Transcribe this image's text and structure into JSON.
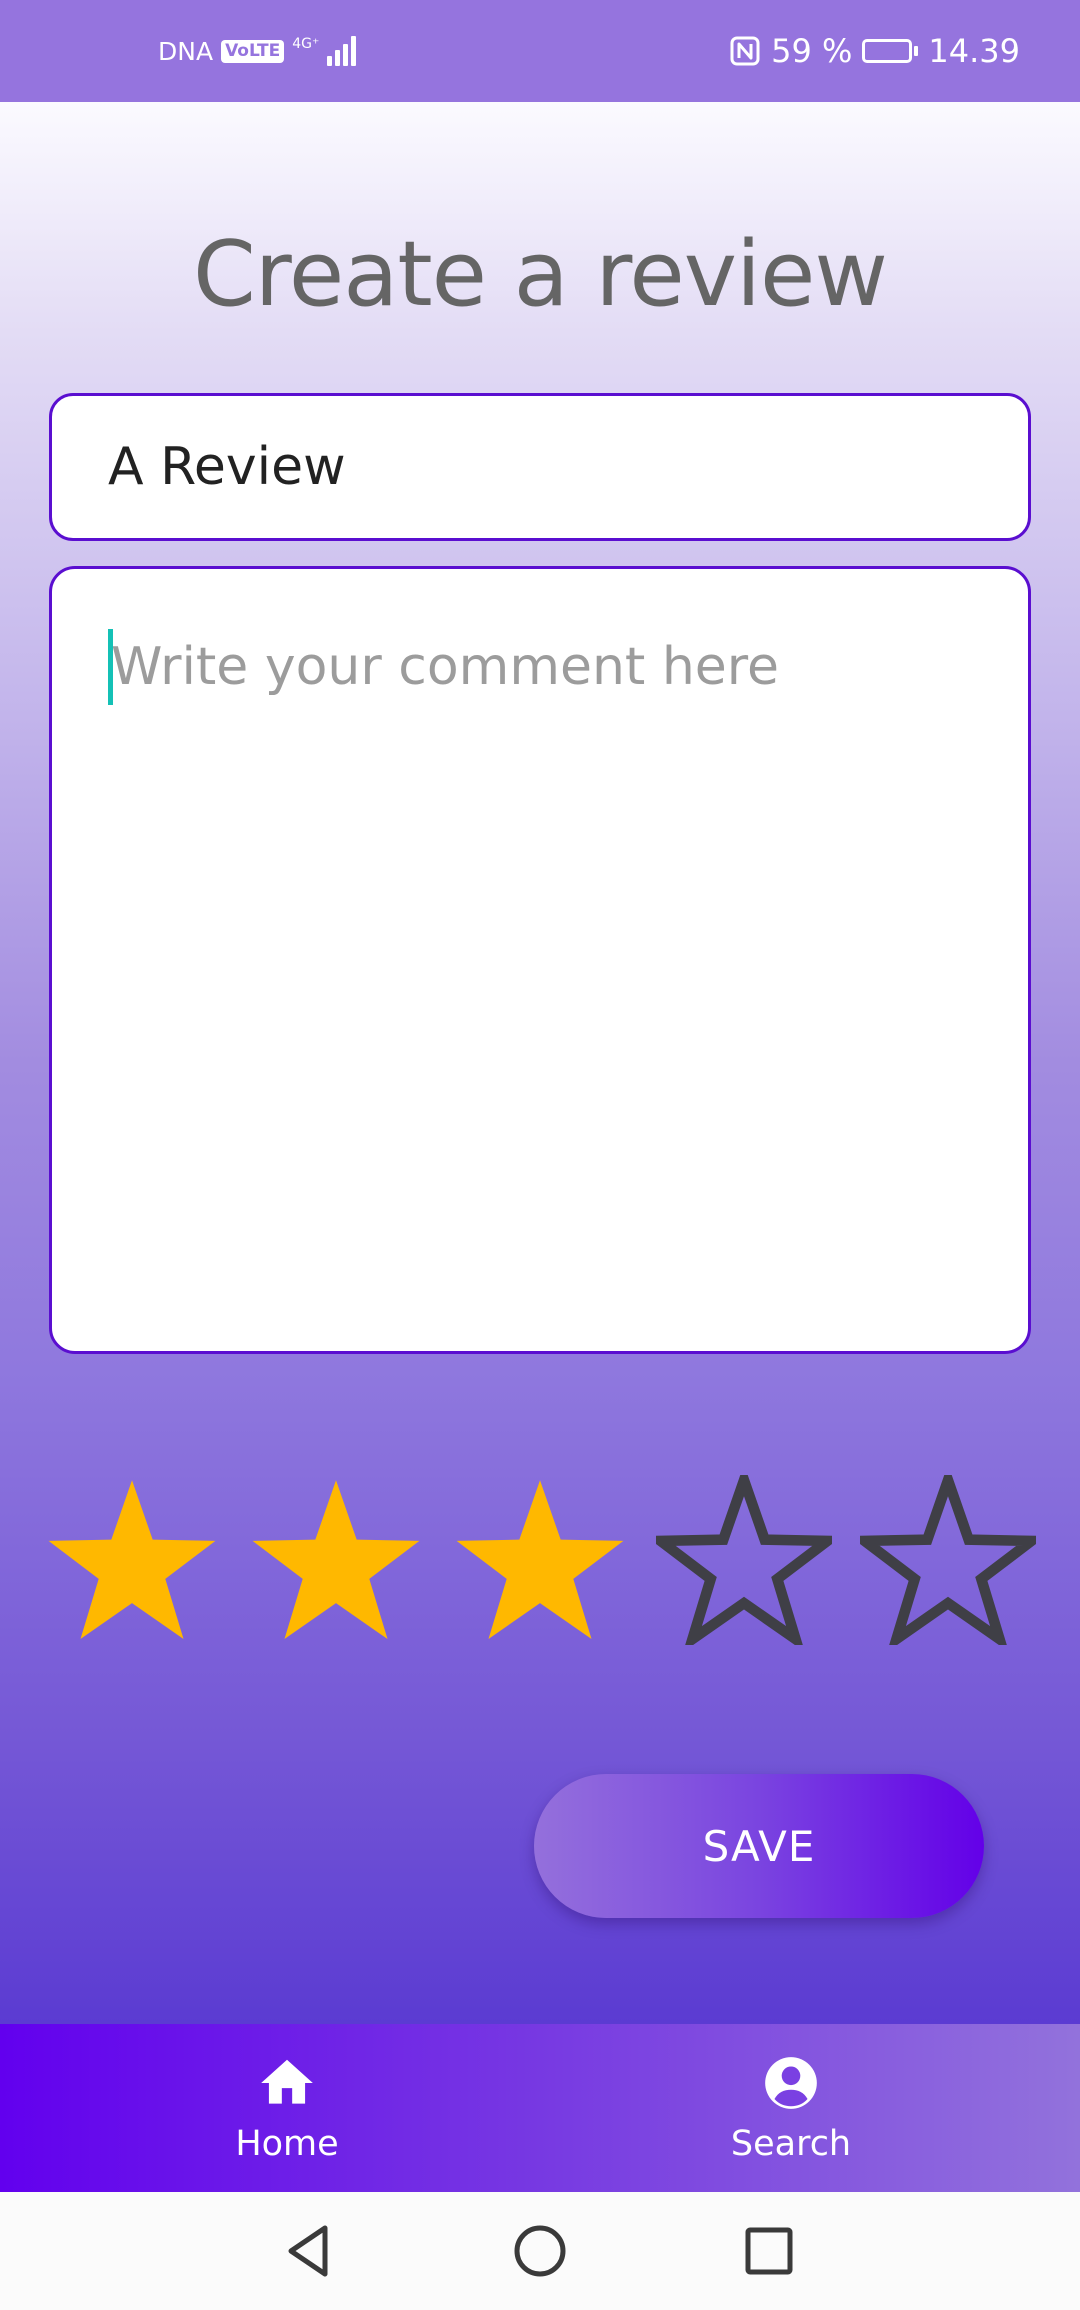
{
  "status_bar": {
    "carrier": "DNA",
    "volte": "VoLTE",
    "network": "4G⁺",
    "battery_percent": "59 %",
    "battery_level": 0.59,
    "time": "14.39"
  },
  "page": {
    "title": "Create a review"
  },
  "form": {
    "title_value": "A Review",
    "comment_value": "",
    "comment_placeholder": "Write your comment here",
    "rating": 3,
    "rating_max": 5,
    "star_filled_color": "#FFB800",
    "star_empty_color": "#3f3f46",
    "save_label": "SAVE"
  },
  "bottom_nav": {
    "items": [
      {
        "label": "Home",
        "icon": "home-icon"
      },
      {
        "label": "Search",
        "icon": "account-circle-icon"
      }
    ]
  },
  "system_nav": {
    "buttons": [
      "back-icon",
      "home-circle-icon",
      "recents-icon"
    ]
  }
}
